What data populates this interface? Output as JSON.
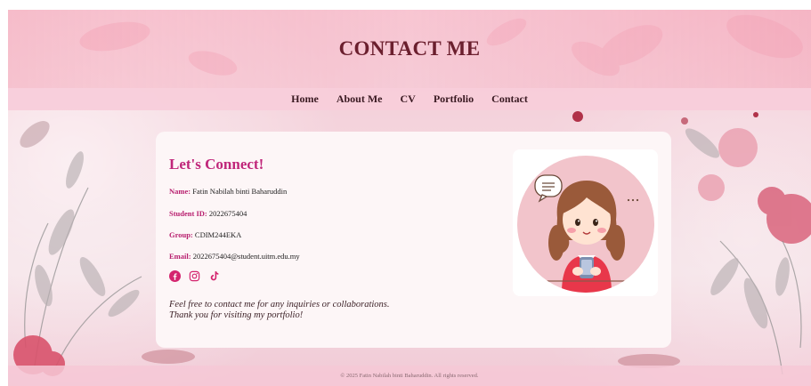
{
  "header": {
    "title": "CONTACT ME"
  },
  "nav": {
    "items": [
      {
        "label": "Home"
      },
      {
        "label": "About Me"
      },
      {
        "label": "CV"
      },
      {
        "label": "Portfolio"
      },
      {
        "label": "Contact"
      }
    ]
  },
  "contact": {
    "title": "Let's Connect!",
    "fields": [
      {
        "label": "Name:",
        "value": "Fatin Nabilah binti Baharuddin"
      },
      {
        "label": "Student ID:",
        "value": "2022675404"
      },
      {
        "label": "Group:",
        "value": "CDIM244EKA"
      },
      {
        "label": "Email:",
        "value": "2022675404@student.uitm.edu.my"
      }
    ],
    "socials": [
      "facebook-icon",
      "instagram-icon",
      "tiktok-icon"
    ],
    "note_line1": "Feel free to contact me for any inquiries or collaborations.",
    "note_line2": "Thank you for visiting my portfolio!"
  },
  "footer": {
    "text": "© 2025 Fatin Nabilah binti Baharuddin. All rights reserved."
  },
  "colors": {
    "accent": "#c0267a",
    "title": "#6b1f2e",
    "background": "#f4d3dc",
    "card": "#fdf6f7"
  }
}
